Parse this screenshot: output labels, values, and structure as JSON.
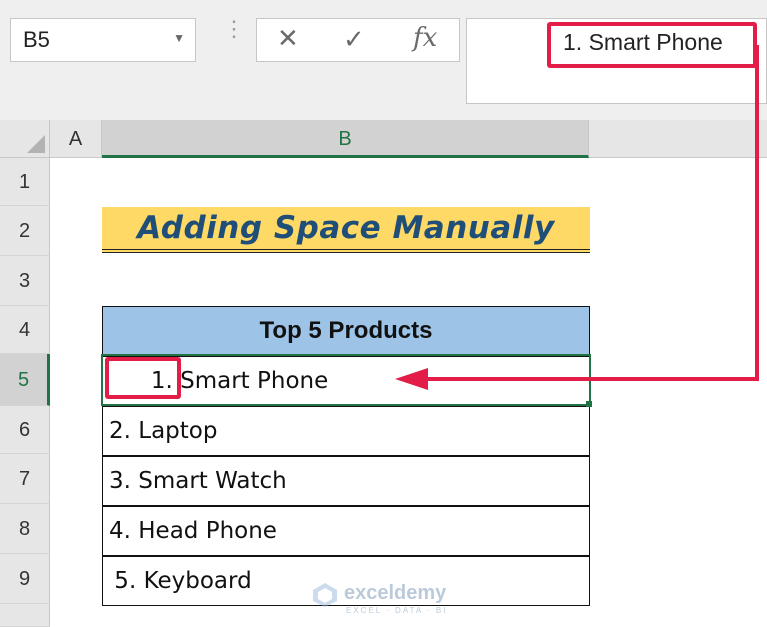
{
  "name_box": {
    "value": "B5"
  },
  "formula_bar": {
    "cancel_glyph": "✕",
    "enter_glyph": "✓",
    "fx_label": "fx",
    "content": "1. Smart Phone"
  },
  "columns": [
    {
      "label": "A",
      "selected": false
    },
    {
      "label": "B",
      "selected": true
    }
  ],
  "rows": [
    "1",
    "2",
    "3",
    "4",
    "5",
    "6",
    "7",
    "8",
    "9"
  ],
  "selected_row": "5",
  "sheet": {
    "title": "Adding Space Manually",
    "table_header": "Top 5 Products",
    "items": [
      "      1. Smart Phone",
      "2. Laptop",
      "3. Smart Watch",
      "4. Head Phone",
      " 5. Keyboard"
    ]
  },
  "watermark": {
    "name": "exceldemy",
    "tagline": "EXCEL · DATA · BI"
  },
  "colors": {
    "accent_green": "#217346",
    "title_fill": "#ffd966",
    "title_text": "#1f4e79",
    "header_fill": "#9dc3e6",
    "annotation_red": "#e11d48"
  },
  "icons": [
    "chevron-down-icon",
    "more-vertical-icon",
    "cancel-icon",
    "check-icon",
    "fx-icon",
    "select-all-icon",
    "exceldemy-logo-icon"
  ]
}
